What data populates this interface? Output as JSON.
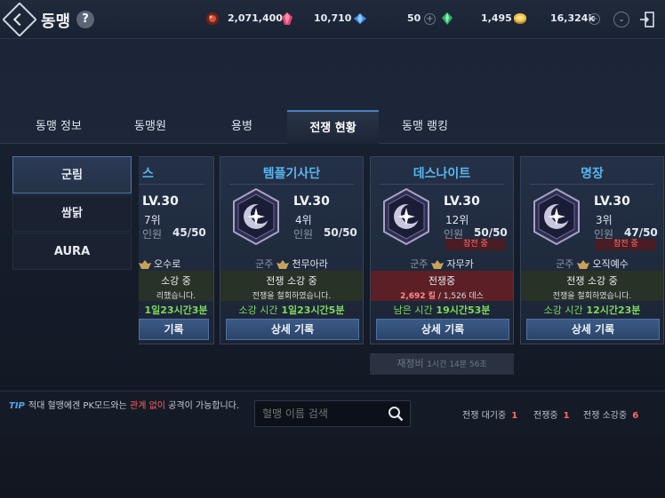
{
  "header": {
    "title": "동맹",
    "help": "?",
    "resources": [
      {
        "icon": "red-orb-icon",
        "value": "2,071,400"
      },
      {
        "icon": "pink-crystal-icon",
        "value": "10,710"
      },
      {
        "icon": "blue-gem-icon",
        "value": "50"
      },
      {
        "icon": "green-gem-icon",
        "value": "1,495"
      },
      {
        "icon": "gold-coin-icon",
        "value": "16,324k"
      }
    ],
    "plus": "+",
    "collapse": "⌄"
  },
  "tabs": [
    "동맹 정보",
    "동맹원",
    "용병",
    "전쟁 현황",
    "동맹 랭킹"
  ],
  "sidebar": [
    "군림",
    "쌈닭",
    "AURA"
  ],
  "cards": [
    {
      "name": "스",
      "level": "LV.30",
      "rank": "7위",
      "member_label": "인원",
      "members": "45/50",
      "leader": "오수로",
      "status": "소강 중",
      "status_sub": "리했습니다.",
      "timer": "1일23시간3분",
      "detail": "기록"
    },
    {
      "name": "템플기사단",
      "level": "LV.30",
      "rank": "4위",
      "member_label": "인원",
      "members": "50/50",
      "leader_label": "군주",
      "leader": "천무아라",
      "status": "전쟁 소강 중",
      "status_sub": "전쟁을 철회하였습니다.",
      "timer_label": "소강 시간",
      "timer": "1일23시간5분",
      "detail": "상세 기록"
    },
    {
      "name": "데스나이트",
      "level": "LV.30",
      "rank": "12위",
      "member_label": "인원",
      "members": "50/50",
      "badge": "참전 중",
      "leader_label": "군주",
      "leader": "자무카",
      "status": "전쟁중",
      "kills": "2,692 킬",
      "kills_sep": "/",
      "deaths": "1,526 데스",
      "timer_label": "남은 시간",
      "timer": "19시간53분",
      "detail": "상세 기록"
    },
    {
      "name": "명장",
      "level": "LV.30",
      "rank": "3위",
      "member_label": "인원",
      "members": "47/50",
      "badge": "참전 중",
      "leader_label": "군주",
      "leader": "오직예수",
      "status": "전쟁 소강 중",
      "status_sub": "전쟁을 철회하였습니다.",
      "timer_label": "소강 시간",
      "timer": "12시간23분",
      "detail": "상세 기록"
    }
  ],
  "recon": {
    "label": "재정비",
    "time": "1시간 14분 56초"
  },
  "footer": {
    "tip_label": "TIP",
    "tip_pre": "적대 혈맹에겐 PK모드와는 ",
    "tip_highlight": "관계 없이",
    "tip_post": " 공격이 가능합니다.",
    "search_placeholder": "혈맹 이름 검색",
    "stats": [
      {
        "label": "전쟁 대기중",
        "value": "1"
      },
      {
        "label": "전쟁중",
        "value": "1"
      },
      {
        "label": "전쟁 소강중",
        "value": "6"
      }
    ]
  },
  "colors": {
    "accent": "#58b6f0",
    "war": "#ff6f76",
    "green": "#7ed85a"
  }
}
